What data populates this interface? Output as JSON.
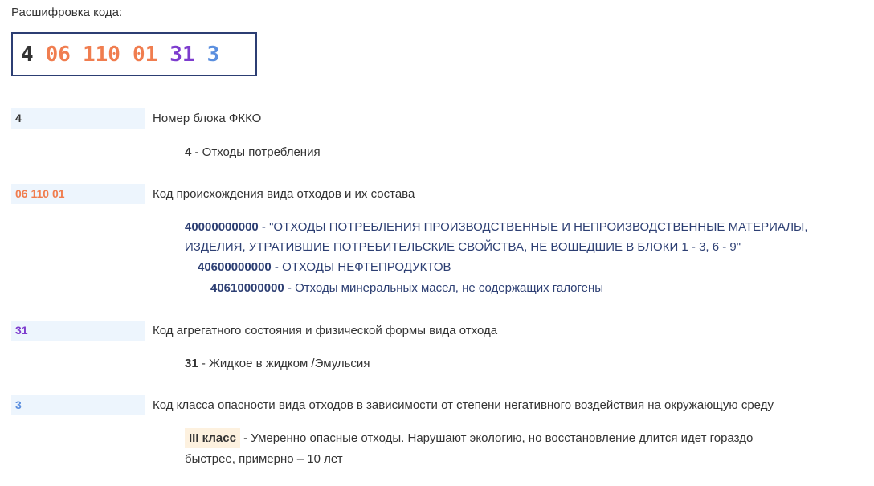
{
  "heading": "Расшифровка кода:",
  "code_parts": [
    {
      "text": "4",
      "color": "#333333"
    },
    {
      "text": "06",
      "color": "#f07d4f"
    },
    {
      "text": "110",
      "color": "#f07d4f"
    },
    {
      "text": "01",
      "color": "#f07d4f"
    },
    {
      "text": "31",
      "color": "#7d3cce"
    },
    {
      "text": "3",
      "color": "#5b8fdf"
    }
  ],
  "sections": [
    {
      "code": "4",
      "code_color": "#333333",
      "title": "Номер блока ФККО",
      "detail_code": "4",
      "detail_text": " - Отходы потребления"
    },
    {
      "code": "06 110 01",
      "code_color": "#f07d4f",
      "title": "Код происхождения вида отходов и их состава",
      "entries": [
        {
          "code": "40000000000",
          "text": " - \"ОТХОДЫ ПОТРЕБЛЕНИЯ ПРОИЗВОДСТВЕННЫЕ И НЕПРОИЗВОДСТВЕННЫЕ МАТЕРИАЛЫ,",
          "text2": "ИЗДЕЛИЯ, УТРАТИВШИЕ ПОТРЕБИТЕЛЬСКИЕ СВОЙСТВА, НЕ ВОШЕДШИЕ В БЛОКИ 1 - 3, 6 - 9\""
        },
        {
          "code": "40600000000",
          "text": " - ОТХОДЫ НЕФТЕПРОДУКТОВ"
        },
        {
          "code": "40610000000",
          "text": " - Отходы минеральных масел, не содержащих галогены"
        }
      ]
    },
    {
      "code": "31",
      "code_color": "#7d3cce",
      "title": "Код агрегатного состояния и физической формы вида отхода",
      "detail_code": "31",
      "detail_text": " - Жидкое в жидком /Эмульсия"
    },
    {
      "code": "3",
      "code_color": "#5b8fdf",
      "title": "Код класса опасности вида отходов в зависимости от степени негативного воздействия на окружающую среду",
      "badge": "III класс",
      "detail_text": " - Умеренно опасные отходы. Нарушают экологию, но восстановление длится идет гораздо",
      "detail_text2": "быстрее, примерно – 10 лет"
    }
  ]
}
